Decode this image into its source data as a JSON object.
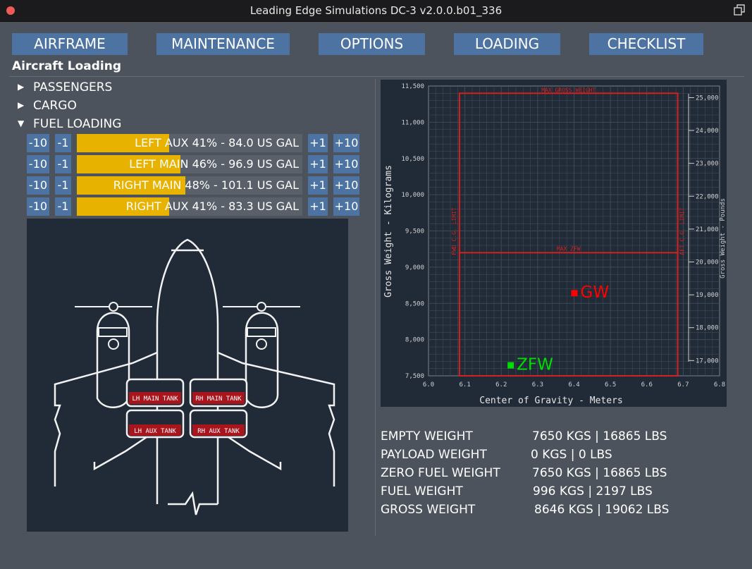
{
  "window": {
    "title": "Leading Edge Simulations DC-3 v2.0.0.b01_336"
  },
  "nav": {
    "airframe": "AIRFRAME",
    "maintenance": "MAINTENANCE",
    "options": "OPTIONS",
    "loading": "LOADING",
    "checklist": "CHECKLIST"
  },
  "section_title": "Aircraft Loading",
  "tree": {
    "passengers": "PASSENGERS",
    "cargo": "CARGO",
    "fuel_loading": "FUEL LOADING"
  },
  "fuel": {
    "dec10": "-10",
    "dec1": "-1",
    "inc1": "+1",
    "inc10": "+10",
    "tanks": [
      {
        "label": "LEFT AUX 41% - 84.0 US GAL",
        "percent": 41
      },
      {
        "label": "LEFT MAIN 46% - 96.9 US GAL",
        "percent": 46
      },
      {
        "label": "RIGHT MAIN 48% - 101.1 US GAL",
        "percent": 48
      },
      {
        "label": "RIGHT AUX 41% - 83.3 US GAL",
        "percent": 41
      }
    ]
  },
  "diagram": {
    "lh_main": "LH MAIN TANK",
    "rh_main": "RH MAIN TANK",
    "lh_aux": "LH AUX TANK",
    "rh_aux": "RH AUX TANK"
  },
  "chart_data": {
    "type": "scatter",
    "xlabel": "Center of Gravity - Meters",
    "ylabel": "Gross Weight - Kilograms",
    "y2label": "Gross Weight - Pounds",
    "xlim": [
      6.0,
      6.8
    ],
    "ylim": [
      7500,
      11500
    ],
    "x_ticks": [
      "6.0",
      "6.1",
      "6.2",
      "6.3",
      "6.4",
      "6.5",
      "6.6",
      "6.7",
      "6.8"
    ],
    "y_ticks": [
      "7,500",
      "8,000",
      "8,500",
      "9,000",
      "9,500",
      "10,000",
      "10,500",
      "11,000",
      "11,500"
    ],
    "y2_ticks": [
      "17,000",
      "18,000",
      "19,000",
      "20,000",
      "21,000",
      "22,000",
      "23,000",
      "24,000",
      "25,000"
    ],
    "grid": true,
    "envelope": {
      "max_gross_label": "MAX GROSS WEIGHT",
      "max_zfw_label": "MAX ZFW",
      "fwd_limit_label": "FWD C.G. LIMIT",
      "aft_limit_label": "AFT C.G. LIMIT",
      "fwd_cg": 6.085,
      "aft_cg": 6.685,
      "max_gross": 11400,
      "max_zfw": 9200
    },
    "points": [
      {
        "name": "GW",
        "x": 6.4,
        "y": 8646,
        "color": "#ff0000"
      },
      {
        "name": "ZFW",
        "x": 6.225,
        "y": 7650,
        "color": "#00dd00"
      }
    ]
  },
  "weights": [
    {
      "label": "EMPTY WEIGHT",
      "value": "7650 KGS   |   16865 LBS"
    },
    {
      "label": "PAYLOAD WEIGHT",
      "value": "0 KGS   |   0 LBS"
    },
    {
      "label": "ZERO FUEL WEIGHT",
      "value": "7650 KGS   |   16865 LBS"
    },
    {
      "label": "FUEL WEIGHT",
      "value": "996 KGS   |   2197 LBS"
    },
    {
      "label": "GROSS WEIGHT",
      "value": "8646 KGS   |   19062 LBS"
    }
  ],
  "colors": {
    "button": "#4c73a1",
    "fuel_fill": "#e8b201",
    "envelope": "#d42020",
    "panel": "#212a37"
  }
}
